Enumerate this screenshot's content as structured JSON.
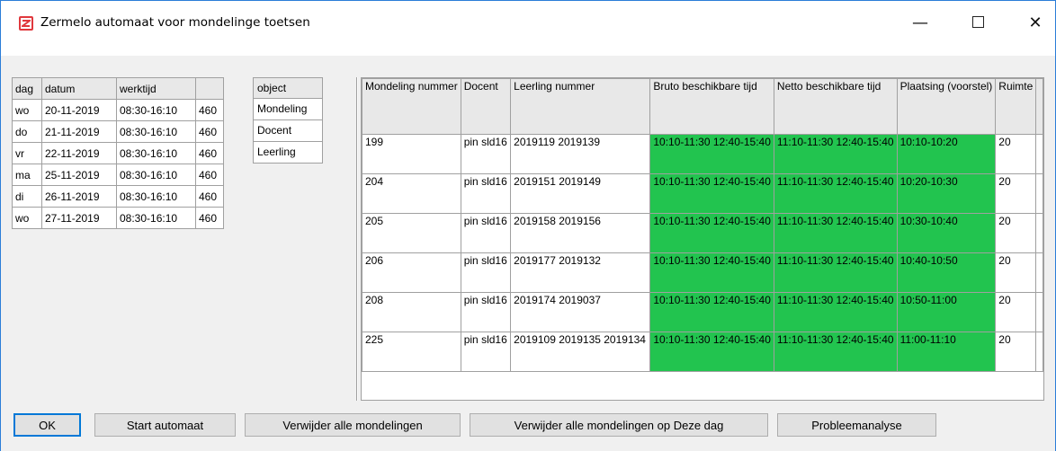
{
  "window": {
    "title": "Zermelo automaat voor mondelinge toetsen",
    "minimize_glyph": "—",
    "close_glyph": "✕"
  },
  "days": {
    "headers": [
      "dag",
      "datum",
      "werktijd",
      ""
    ],
    "rows": [
      [
        "wo",
        "20-11-2019",
        "08:30-16:10",
        "460"
      ],
      [
        "do",
        "21-11-2019",
        "08:30-16:10",
        "460"
      ],
      [
        "vr",
        "22-11-2019",
        "08:30-16:10",
        "460"
      ],
      [
        "ma",
        "25-11-2019",
        "08:30-16:10",
        "460"
      ],
      [
        "di",
        "26-11-2019",
        "08:30-16:10",
        "460"
      ],
      [
        "wo",
        "27-11-2019",
        "08:30-16:10",
        "460"
      ]
    ]
  },
  "objects": {
    "header": "object",
    "items": [
      "Mondeling",
      "Docent",
      "Leerling"
    ]
  },
  "main": {
    "headers": [
      "Mondeling nummer",
      "Docent",
      "Leerling nummer",
      "Bruto beschikbare tijd",
      "Netto beschikbare tijd",
      "Plaatsing (voorstel)",
      "Ruimte",
      ""
    ],
    "rows": [
      {
        "nummer": "199",
        "docent": "pin sld16",
        "leerling": "2019119 2019139",
        "bruto": "10:10-11:30 12:40-15:40",
        "netto": "11:10-11:30 12:40-15:40",
        "plaatsing": "10:10-10:20",
        "ruimte": "20"
      },
      {
        "nummer": "204",
        "docent": "pin sld16",
        "leerling": "2019151 2019149",
        "bruto": "10:10-11:30 12:40-15:40",
        "netto": "11:10-11:30 12:40-15:40",
        "plaatsing": "10:20-10:30",
        "ruimte": "20"
      },
      {
        "nummer": "205",
        "docent": "pin sld16",
        "leerling": "2019158 2019156",
        "bruto": "10:10-11:30 12:40-15:40",
        "netto": "11:10-11:30 12:40-15:40",
        "plaatsing": "10:30-10:40",
        "ruimte": "20"
      },
      {
        "nummer": "206",
        "docent": "pin sld16",
        "leerling": "2019177 2019132",
        "bruto": "10:10-11:30 12:40-15:40",
        "netto": "11:10-11:30 12:40-15:40",
        "plaatsing": "10:40-10:50",
        "ruimte": "20"
      },
      {
        "nummer": "208",
        "docent": "pin sld16",
        "leerling": "2019174 2019037",
        "bruto": "10:10-11:30 12:40-15:40",
        "netto": "11:10-11:30 12:40-15:40",
        "plaatsing": "10:50-11:00",
        "ruimte": "20"
      },
      {
        "nummer": "225",
        "docent": "pin sld16",
        "leerling": "2019109 2019135 2019134",
        "bruto": "10:10-11:30 12:40-15:40",
        "netto": "11:10-11:30 12:40-15:40",
        "plaatsing": "11:00-11:10",
        "ruimte": "20"
      }
    ],
    "highlight_color": "#22c44f"
  },
  "buttons": {
    "ok": "OK",
    "start": "Start automaat",
    "remove_all": "Verwijder alle mondelingen",
    "remove_day": "Verwijder alle mondelingen op Deze dag",
    "analysis": "Probleemanalyse"
  }
}
